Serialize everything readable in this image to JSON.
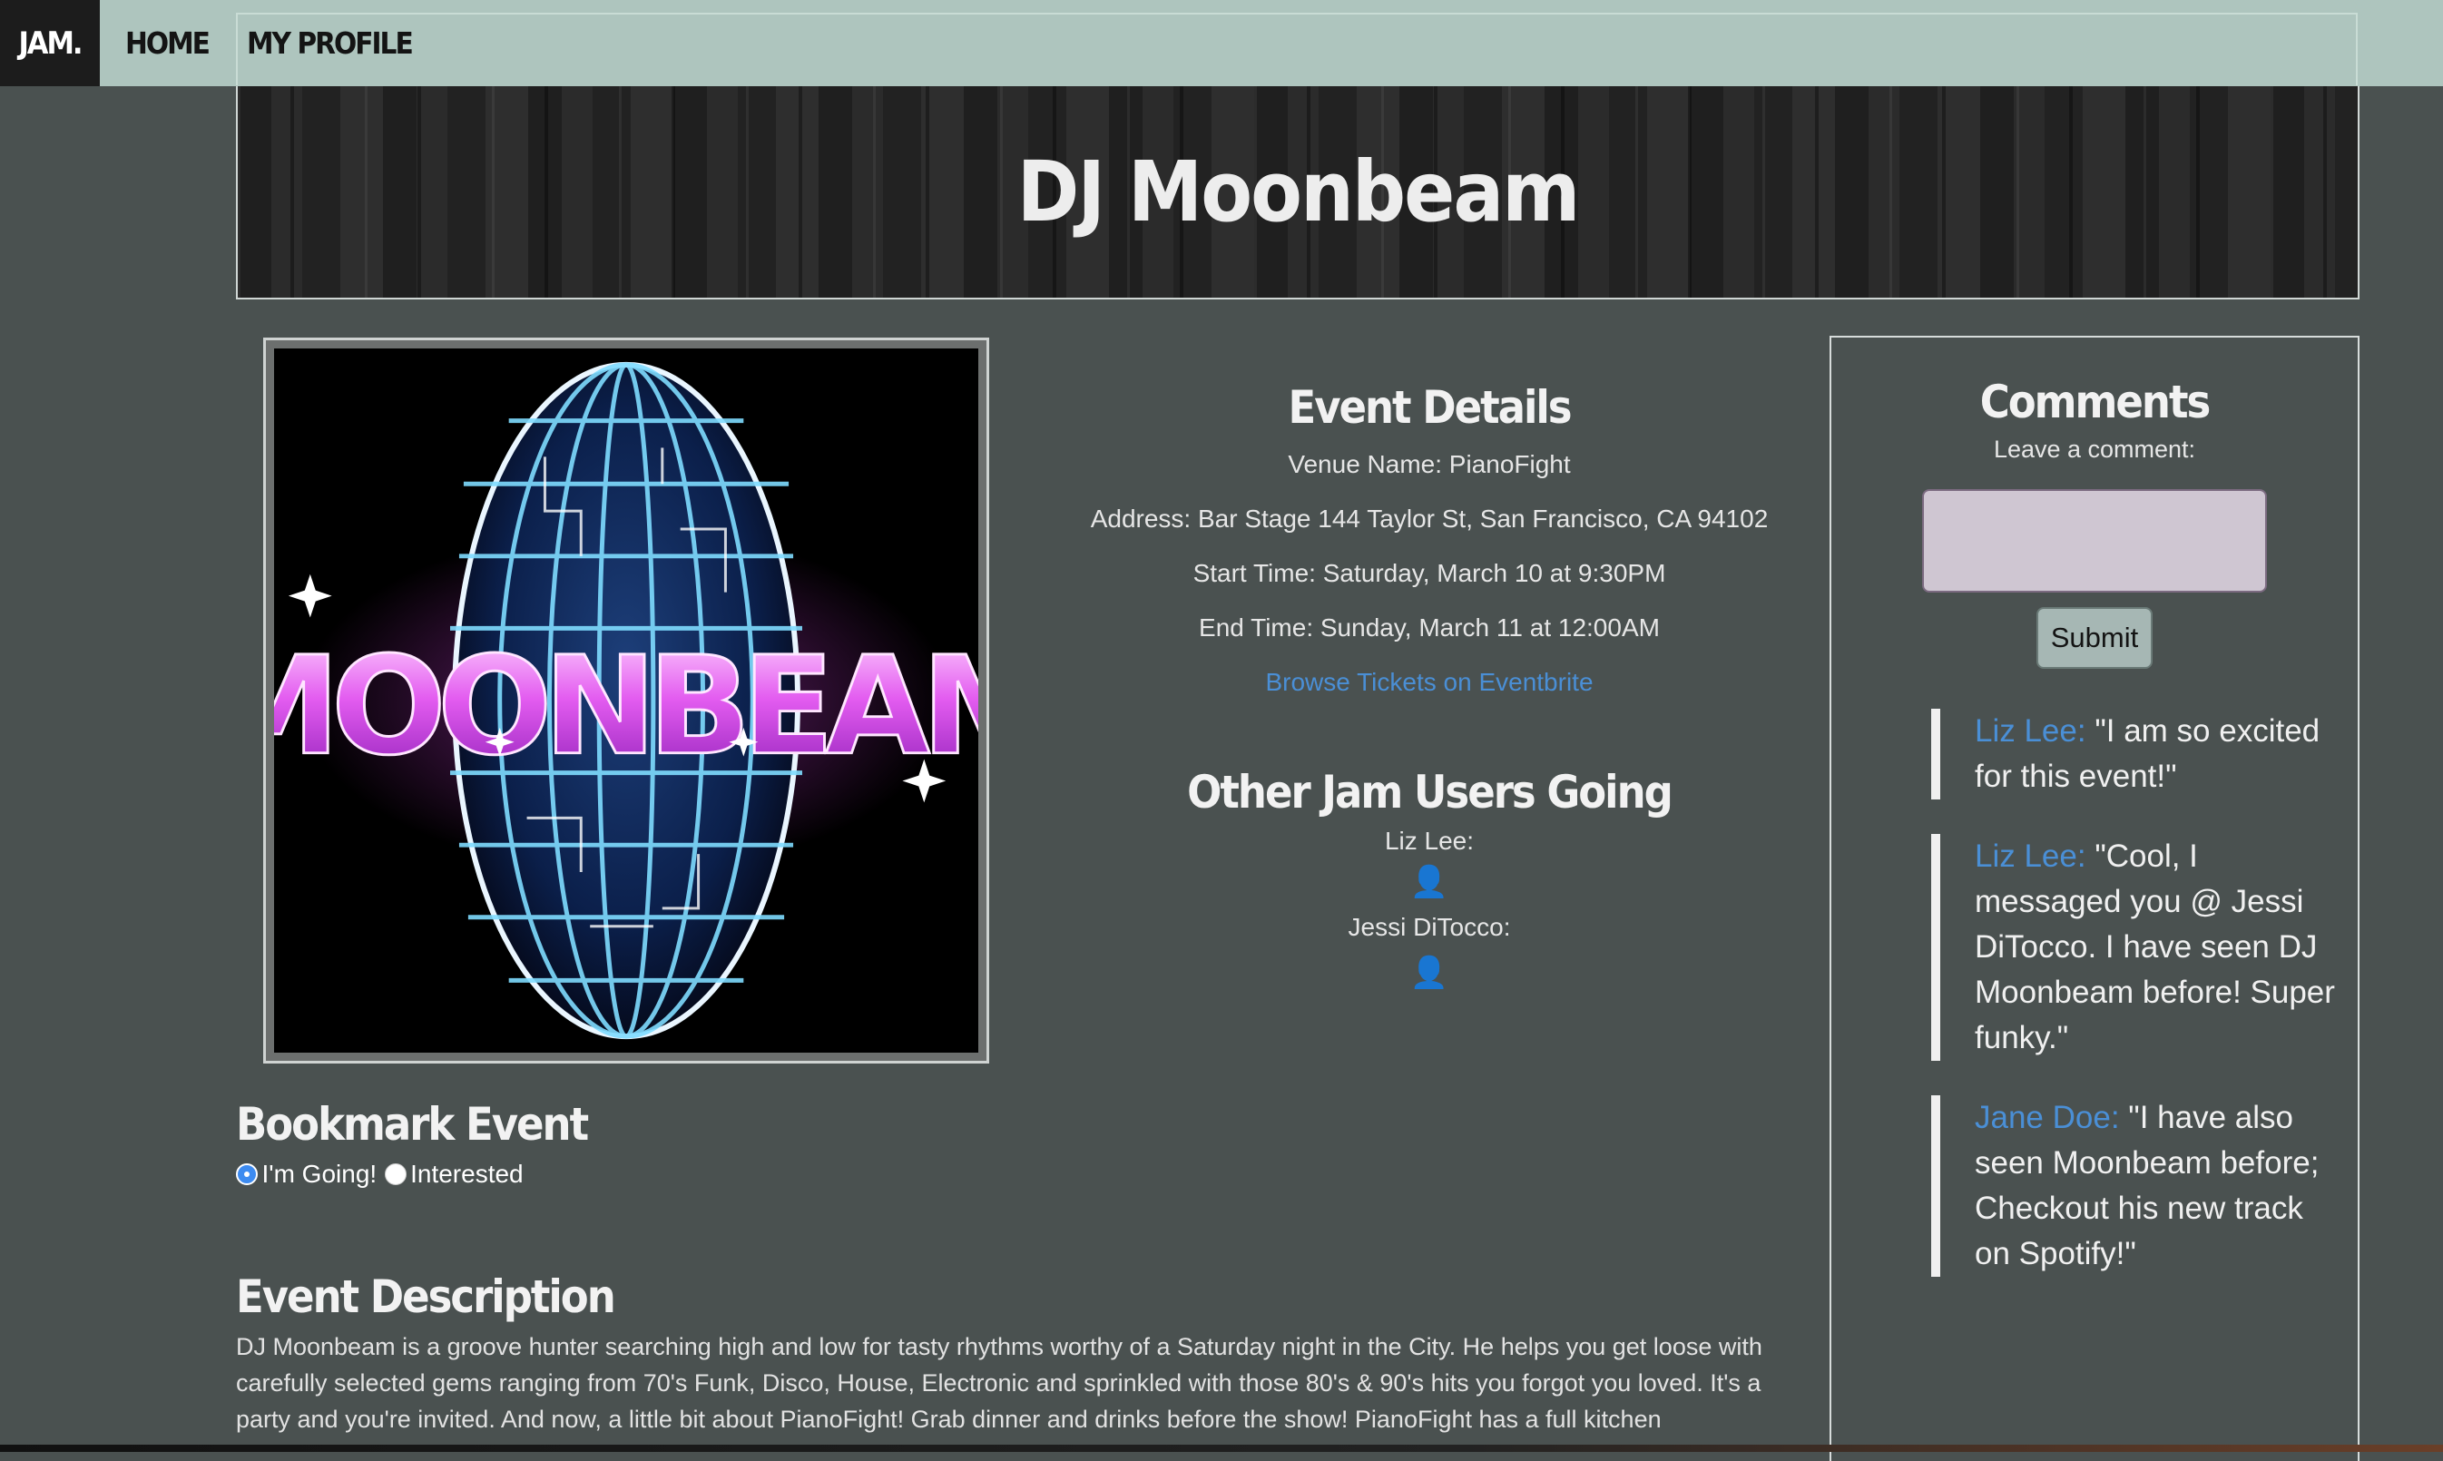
{
  "nav": {
    "brand": "JAM.",
    "home": "HOME",
    "profile": "MY PROFILE"
  },
  "hero": {
    "title": "DJ Moonbeam"
  },
  "event_image": {
    "text": "MOONBEAM"
  },
  "details": {
    "heading": "Event Details",
    "venue": "Venue Name: PianoFight",
    "address": "Address: Bar Stage 144 Taylor St, San Francisco, CA 94102",
    "start": "Start Time: Saturday, March 10 at 9:30PM",
    "end": "End Time: Sunday, March 11 at 12:00AM",
    "tickets_link": "Browse Tickets on Eventbrite"
  },
  "going": {
    "heading": "Other Jam Users Going",
    "users": [
      {
        "name": "Liz Lee:"
      },
      {
        "name": "Jessi DiTocco:"
      }
    ]
  },
  "bookmark": {
    "heading": "Bookmark Event",
    "options": [
      {
        "label": "I'm Going!",
        "selected": true
      },
      {
        "label": "Interested",
        "selected": false
      }
    ]
  },
  "description": {
    "heading": "Event Description",
    "text": "DJ Moonbeam is a groove hunter searching high and low for tasty rhythms worthy of a Saturday night in the City. He helps you get loose with carefully selected gems ranging from 70's Funk, Disco, House, Electronic and sprinkled with those 80's & 90's hits you forgot you loved. It's a party and you're invited. And now, a little bit about PianoFight! Grab dinner and drinks before the show! PianoFight has a full kitchen"
  },
  "comments": {
    "heading": "Comments",
    "prompt": "Leave a comment:",
    "input_value": "",
    "submit_label": "Submit",
    "items": [
      {
        "author": "Liz Lee:",
        "text": " \"I am so excited for this event!\""
      },
      {
        "author": "Liz Lee:",
        "text": " \"Cool, I messaged you @ Jessi DiTocco. I have seen DJ Moonbeam before! Super funky.\""
      },
      {
        "author": "Jane Doe:",
        "text": " \"I have also seen Moonbeam before; Checkout his new track on Spotify!\""
      }
    ]
  },
  "colors": {
    "background": "#4a5150",
    "nav": "#aec5be",
    "link": "#4a8fd6",
    "radio_selected": "#3d8bf0"
  },
  "icons": [
    "user-icon",
    "radio-selected",
    "radio-unselected"
  ]
}
